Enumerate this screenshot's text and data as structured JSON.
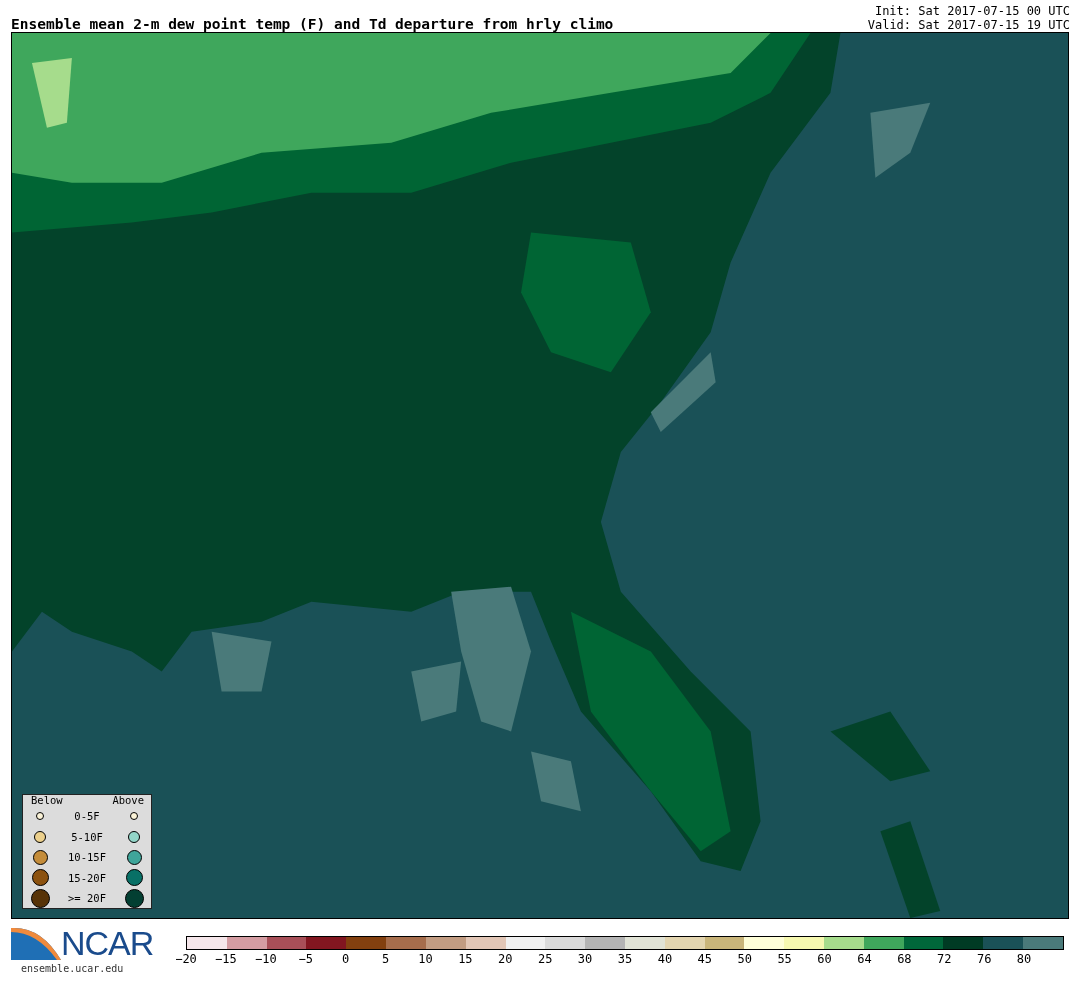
{
  "title": "Ensemble mean 2-m dew point temp (F) and Td departure from hrly climo",
  "init": "Init: Sat 2017-07-15 00 UTC",
  "valid": "Valid: Sat 2017-07-15 19 UTC",
  "legend": {
    "below_label": "Below",
    "above_label": "Above",
    "rows": [
      {
        "label": "0-5F",
        "below": {
          "color": "#fbf3d8"
        },
        "above": {
          "color": "#fbf3d8"
        }
      },
      {
        "label": "5-10F",
        "below": {
          "color": "#ecd08c"
        },
        "above": {
          "color": "#93d6c9"
        }
      },
      {
        "label": "10-15F",
        "below": {
          "color": "#c48c3a"
        },
        "above": {
          "color": "#3fa59a"
        }
      },
      {
        "label": "15-20F",
        "below": {
          "color": "#8c520f"
        },
        "above": {
          "color": "#087066"
        }
      },
      {
        "label": ">= 20F",
        "below": {
          "color": "#573307"
        },
        "above": {
          "color": "#033f32"
        }
      }
    ]
  },
  "logo": {
    "text": "NCAR",
    "url": "ensemble.ucar.edu"
  },
  "colorbar": {
    "bins": [
      {
        "color": "#f5e6ea"
      },
      {
        "color": "#d49ca2"
      },
      {
        "color": "#a84f58"
      },
      {
        "color": "#821620"
      },
      {
        "color": "#83400f"
      },
      {
        "color": "#a66d4c"
      },
      {
        "color": "#c29c82"
      },
      {
        "color": "#e2c6b6"
      },
      {
        "color": "#f0f0f0"
      },
      {
        "color": "#dadada"
      },
      {
        "color": "#b4b4b4"
      },
      {
        "color": "#e1e3d6"
      },
      {
        "color": "#e3d5b0"
      },
      {
        "color": "#c9b57a"
      },
      {
        "color": "#fefed8"
      },
      {
        "color": "#f6f8b0"
      },
      {
        "color": "#a6dc8c"
      },
      {
        "color": "#3fa75c"
      },
      {
        "color": "#00673a"
      },
      {
        "color": "#003b24"
      },
      {
        "color": "#1a5157"
      },
      {
        "color": "#4a7a7a"
      }
    ],
    "ticks": [
      "−20",
      "−15",
      "−10",
      "−5",
      "0",
      "5",
      "10",
      "15",
      "20",
      "25",
      "30",
      "35",
      "40",
      "45",
      "50",
      "55",
      "60",
      "64",
      "68",
      "72",
      "76",
      "80"
    ]
  }
}
